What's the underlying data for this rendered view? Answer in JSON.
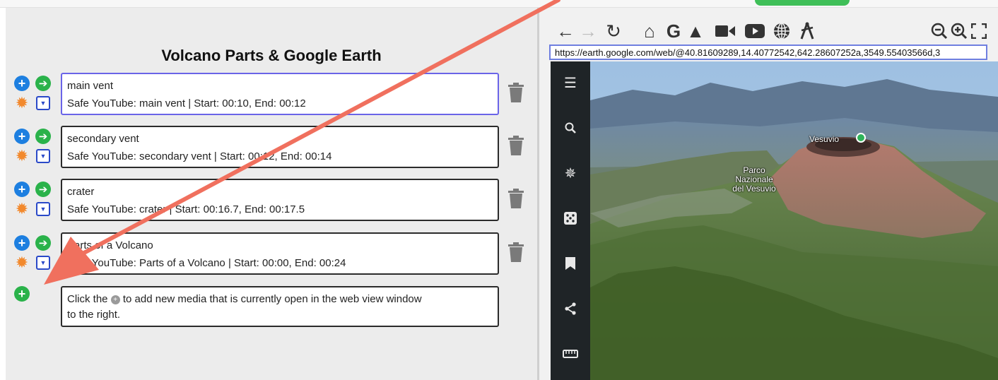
{
  "app": {
    "page_title": "Volcano Parts & Google Earth"
  },
  "media_list": [
    {
      "title": "main vent",
      "detail": "Safe YouTube: main vent | Start: 00:10, End: 00:12",
      "active": true
    },
    {
      "title": "secondary vent",
      "detail": "Safe YouTube: secondary vent | Start: 00:12, End: 00:14",
      "active": false
    },
    {
      "title": "crater",
      "detail": "Safe YouTube: crater | Start: 00:16.7, End: 00:17.5",
      "active": false
    },
    {
      "title": "Parts of a Volcano",
      "detail": "Safe YouTube: Parts of a Volcano | Start: 00:00, End: 00:24",
      "active": false
    }
  ],
  "hint": {
    "before": "Click the",
    "after": "to add new media that is currently open in the web view window",
    "line2": "to the right."
  },
  "webview": {
    "url": "https://earth.google.com/web/@40.81609289,14.40772542,642.28607252a,3549.55403566d,3",
    "toolbar_icons": [
      "back-arrow-icon",
      "forward-arrow-icon",
      "reload-icon",
      "home-icon",
      "google-icon",
      "drive-icon",
      "video-camera-icon",
      "youtube-icon",
      "globe-icon",
      "compass-icon",
      "zoom-out-icon",
      "zoom-in-icon",
      "fullscreen-icon"
    ],
    "sidebar_icons": [
      "menu-icon",
      "search-icon",
      "voyager-icon",
      "dice-icon",
      "bookmark-icon",
      "share-icon",
      "ruler-icon"
    ],
    "map_labels": {
      "peak": "Vesuvio",
      "park": [
        "Parco",
        "Nazionale",
        "del Vesuvio"
      ]
    }
  },
  "colors": {
    "accent_blue": "#1d7fe0",
    "accent_green": "#2ab24a",
    "gear_orange": "#f2892d",
    "active_border": "#6a64e8",
    "annotation_arrow": "#f0705e"
  }
}
